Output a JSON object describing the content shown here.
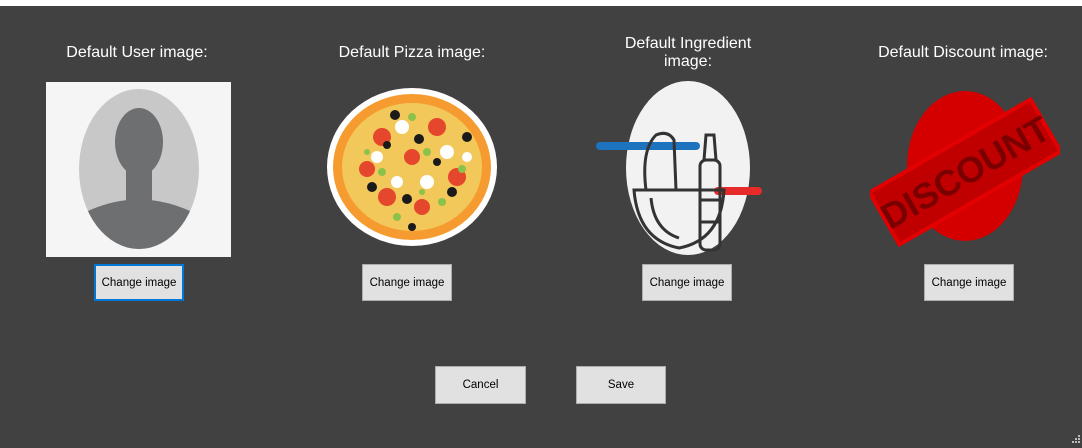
{
  "sections": [
    {
      "title": "Default User image:",
      "button": "Change image",
      "image_icon": "user-avatar-placeholder"
    },
    {
      "title": "Default Pizza image:",
      "button": "Change image",
      "image_icon": "pizza"
    },
    {
      "title": "Default Ingredient image:",
      "button": "Change image",
      "image_icon": "ingredients"
    },
    {
      "title": "Default Discount image:",
      "button": "Change image",
      "image_icon": "discount-stamp"
    }
  ],
  "actions": {
    "cancel": "Cancel",
    "save": "Save"
  },
  "discount_stamp_text": "DISCOUNT",
  "colors": {
    "background": "#414141",
    "button": "#e1e1e1",
    "focus": "#0078d7"
  }
}
